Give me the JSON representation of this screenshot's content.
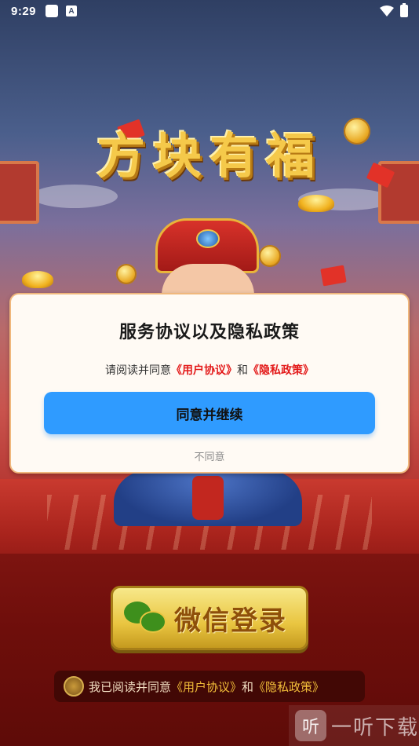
{
  "status_bar": {
    "time": "9:29",
    "a_icon": "A"
  },
  "game": {
    "title": "方块有福"
  },
  "wechat_login": {
    "label": "微信登录"
  },
  "agree_bar": {
    "prefix": "我已阅读并同意",
    "user_agreement": "《用户协议》",
    "and": "和",
    "privacy_policy": "《隐私政策》"
  },
  "dialog": {
    "title": "服务协议以及隐私政策",
    "text_prefix": "请阅读并同意",
    "user_agreement": "《用户协议》",
    "and": "和",
    "privacy_policy": "《隐私政策》",
    "primary_button": "同意并继续",
    "decline": "不同意"
  },
  "watermark": {
    "logo": "听",
    "text": "一听下载"
  },
  "colors": {
    "primary_button": "#2f9bff",
    "link_red": "#e31a1a",
    "dialog_bg": "#fffaf4",
    "dialog_border": "#f0b77c"
  }
}
